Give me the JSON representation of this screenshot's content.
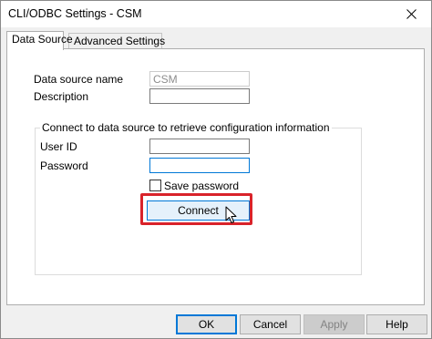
{
  "window": {
    "title": "CLI/ODBC Settings - CSM"
  },
  "tabs": [
    {
      "label": "Data Source",
      "active": true
    },
    {
      "label": "Advanced Settings",
      "active": false
    }
  ],
  "form": {
    "data_source_name": {
      "label": "Data source name",
      "value": "CSM",
      "disabled": true
    },
    "description": {
      "label": "Description",
      "value": ""
    }
  },
  "connect_group": {
    "legend": "Connect to data source to retrieve configuration information",
    "user_id": {
      "label": "User ID",
      "value": ""
    },
    "password": {
      "label": "Password",
      "value": ""
    },
    "save_password": {
      "label": "Save password",
      "checked": false
    },
    "connect_label": "Connect"
  },
  "buttons": {
    "ok": "OK",
    "cancel": "Cancel",
    "apply": "Apply",
    "help": "Help"
  },
  "icons": {
    "close": "close-icon",
    "cursor": "mouse-pointer-icon"
  },
  "colors": {
    "highlight": "#d9232a",
    "focus": "#0078d7"
  }
}
